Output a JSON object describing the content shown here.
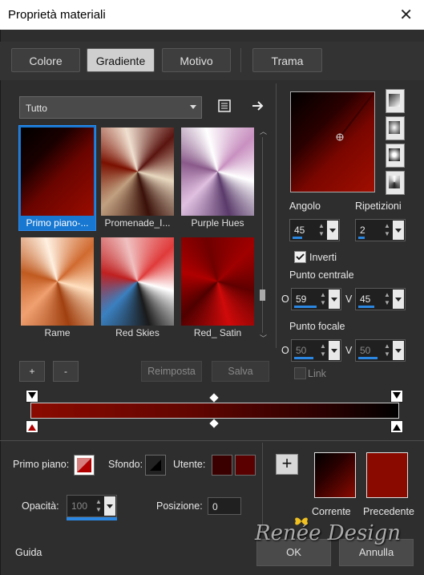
{
  "window": {
    "title": "Proprietà materiali",
    "close_glyph": "✕"
  },
  "tabs": [
    {
      "label": "Colore",
      "active": false
    },
    {
      "label": "Gradiente",
      "active": true
    },
    {
      "label": "Motivo",
      "active": false
    },
    {
      "label": "Trama",
      "active": false
    }
  ],
  "category_select": {
    "value": "Tutto"
  },
  "gradients": [
    {
      "label": "Primo piano-...",
      "selected": true
    },
    {
      "label": "Promenade_I...",
      "selected": false
    },
    {
      "label": "Purple Hues",
      "selected": false
    },
    {
      "label": "Rame",
      "selected": false
    },
    {
      "label": "Red Skies",
      "selected": false
    },
    {
      "label": "Red_ Satin",
      "selected": false
    }
  ],
  "buttons": {
    "add": "+",
    "remove": "-",
    "reset": "Reimposta",
    "save": "Salva",
    "ok": "OK",
    "cancel": "Annulla",
    "help": "Guida",
    "plus_swatch": "+"
  },
  "angle": {
    "label": "Angolo",
    "value": "45"
  },
  "repeats": {
    "label": "Ripetizioni",
    "value": "2"
  },
  "invert": {
    "label": "Inverti",
    "checked": true
  },
  "center_point": {
    "label": "Punto centrale",
    "o_label": "O",
    "o_value": "59",
    "v_label": "V",
    "v_value": "45"
  },
  "focal_point": {
    "label": "Punto focale",
    "o_label": "O",
    "o_value": "50",
    "v_label": "V",
    "v_value": "50"
  },
  "link": {
    "label": "Link",
    "checked": false
  },
  "bottom": {
    "foreground_label": "Primo piano:",
    "background_label": "Sfondo:",
    "user_label": "Utente:",
    "opacity_label": "Opacità:",
    "opacity_value": "100",
    "position_label": "Posizione:",
    "position_value": "0",
    "current_label": "Corrente",
    "previous_label": "Precedente"
  },
  "watermark": "Renée Design",
  "colors": {
    "dark_red": "#5a0000",
    "red": "#8a0a00",
    "black": "#000000",
    "accent_blue": "#1777d1"
  }
}
